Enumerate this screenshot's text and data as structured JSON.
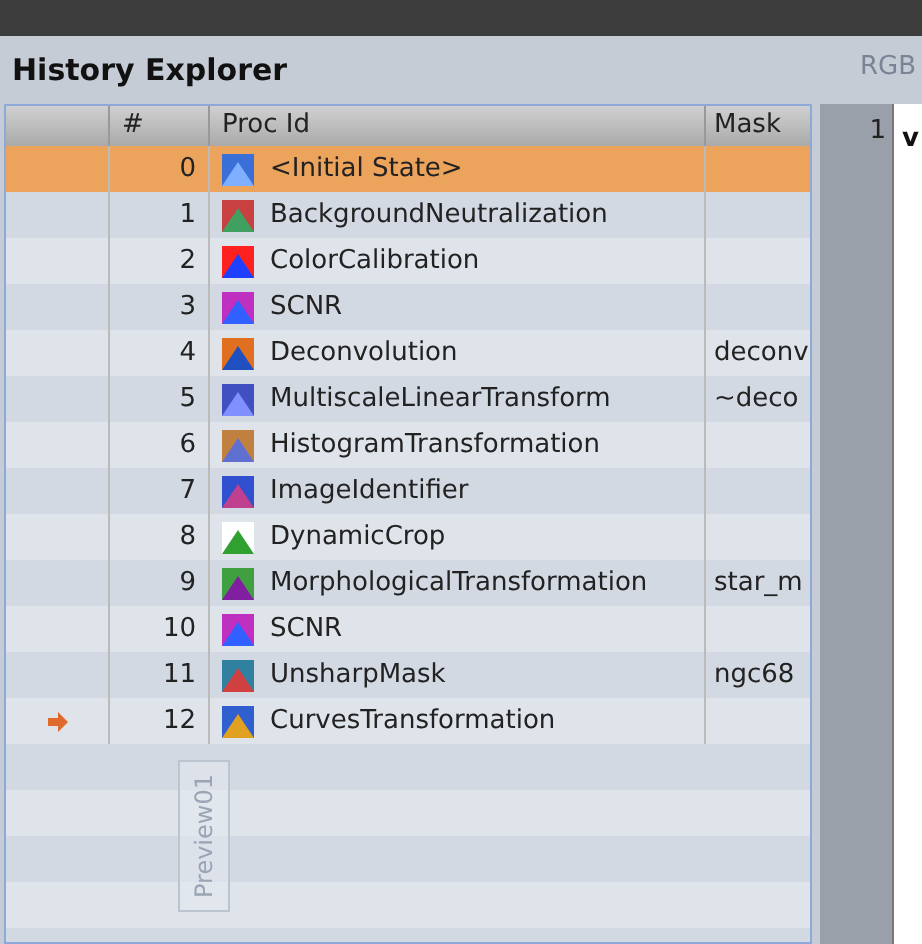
{
  "panel": {
    "title": "History Explorer"
  },
  "background": {
    "image_label": "RGB",
    "preview_tab": "Preview01",
    "side_number": "1",
    "side_text": "v"
  },
  "table": {
    "columns": [
      "#",
      "Proc Id",
      "Mask"
    ],
    "rows": [
      {
        "index": "0",
        "proc": "<Initial State>",
        "mask": "",
        "selected": true,
        "current": false
      },
      {
        "index": "1",
        "proc": "BackgroundNeutralization",
        "mask": "",
        "selected": false,
        "current": false
      },
      {
        "index": "2",
        "proc": "ColorCalibration",
        "mask": "",
        "selected": false,
        "current": false
      },
      {
        "index": "3",
        "proc": "SCNR",
        "mask": "",
        "selected": false,
        "current": false
      },
      {
        "index": "4",
        "proc": "Deconvolution",
        "mask": "deconv",
        "selected": false,
        "current": false
      },
      {
        "index": "5",
        "proc": "MultiscaleLinearTransform",
        "mask": "~deco",
        "selected": false,
        "current": false
      },
      {
        "index": "6",
        "proc": "HistogramTransformation",
        "mask": "",
        "selected": false,
        "current": false
      },
      {
        "index": "7",
        "proc": "ImageIdentifier",
        "mask": "",
        "selected": false,
        "current": false
      },
      {
        "index": "8",
        "proc": "DynamicCrop",
        "mask": "",
        "selected": false,
        "current": false
      },
      {
        "index": "9",
        "proc": "MorphologicalTransformation",
        "mask": "star_m",
        "selected": false,
        "current": false
      },
      {
        "index": "10",
        "proc": "SCNR",
        "mask": "",
        "selected": false,
        "current": false
      },
      {
        "index": "11",
        "proc": "UnsharpMask",
        "mask": "ngc68",
        "selected": false,
        "current": false
      },
      {
        "index": "12",
        "proc": "CurvesTransformation",
        "mask": "",
        "selected": false,
        "current": true
      }
    ]
  }
}
